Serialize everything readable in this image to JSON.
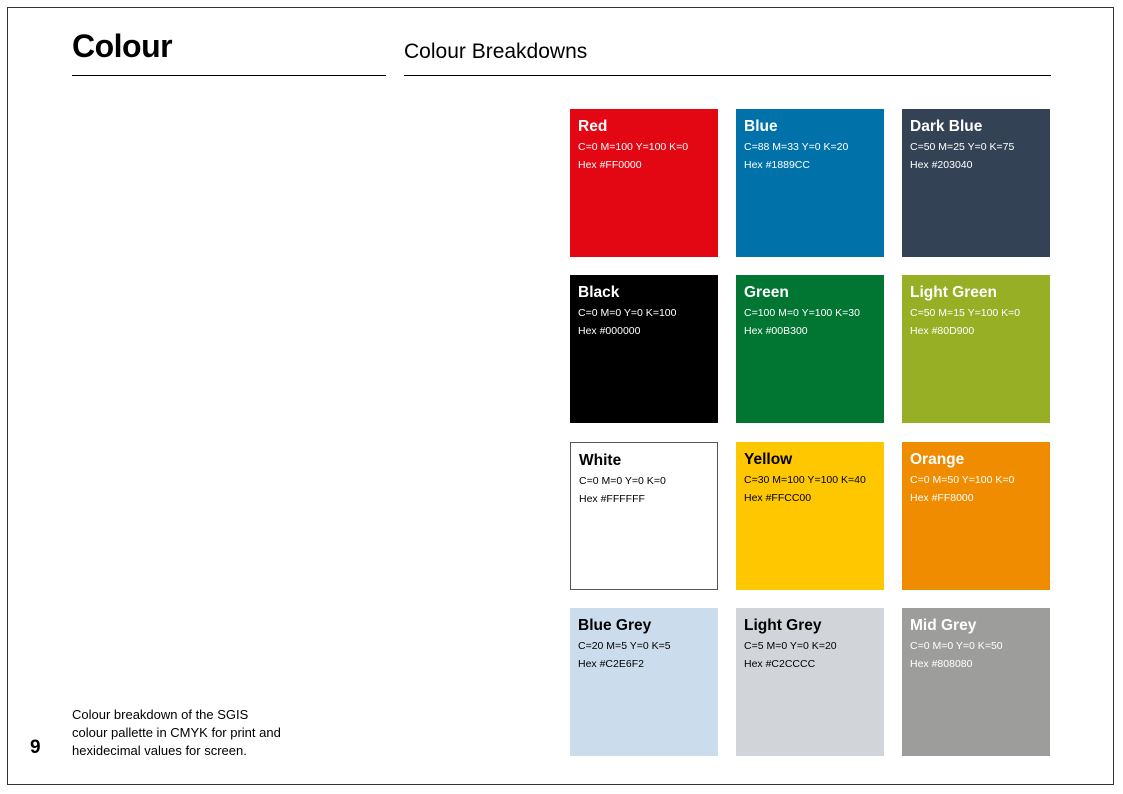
{
  "page": {
    "section_title": "Colour",
    "subtitle": "Colour Breakdowns",
    "page_number": "9",
    "caption_lines": [
      "Colour breakdown of the SGIS",
      "colour pallette in CMYK for print and",
      "hexidecimal values for screen."
    ]
  },
  "swatches": [
    {
      "name": "Red",
      "cmyk": "C=0 M=100 Y=100 K=0",
      "hex": "Hex #FF0000",
      "fill": "#E30613",
      "text_color": "#ffffff"
    },
    {
      "name": "Blue",
      "cmyk": "C=88 M=33 Y=0 K=20",
      "hex": "Hex #1889CC",
      "fill": "#0071A9",
      "text_color": "#ffffff"
    },
    {
      "name": "Dark Blue",
      "cmyk": "C=50 M=25 Y=0 K=75",
      "hex": "Hex #203040",
      "fill": "#344255",
      "text_color": "#ffffff"
    },
    {
      "name": "Black",
      "cmyk": "C=0 M=0 Y=0 K=100",
      "hex": "Hex #000000",
      "fill": "#000000",
      "text_color": "#ffffff"
    },
    {
      "name": "Green",
      "cmyk": "C=100 M=0 Y=100 K=30",
      "hex": "Hex #00B300",
      "fill": "#007632",
      "text_color": "#ffffff"
    },
    {
      "name": "Light Green",
      "cmyk": "C=50 M=15 Y=100 K=0",
      "hex": "Hex #80D900",
      "fill": "#97AF24",
      "text_color": "#ffffff"
    },
    {
      "name": "White",
      "cmyk": "C=0 M=0 Y=0 K=0",
      "hex": "Hex #FFFFFF",
      "fill": "#FFFFFF",
      "text_color": "#000000",
      "border": "#555555"
    },
    {
      "name": "Yellow",
      "cmyk": "C=30 M=100 Y=100 K=40",
      "hex": "Hex #FFCC00",
      "fill": "#FFC700",
      "text_color": "#000000"
    },
    {
      "name": "Orange",
      "cmyk": "C=0 M=50 Y=100 K=0",
      "hex": "Hex #FF8000",
      "fill": "#F08C00",
      "text_color": "#ffffff"
    },
    {
      "name": "Blue Grey",
      "cmyk": "C=20 M=5 Y=0 K=5",
      "hex": "Hex #C2E6F2",
      "fill": "#CBDCEC",
      "text_color": "#000000"
    },
    {
      "name": "Light Grey",
      "cmyk": "C=5 M=0 Y=0 K=20",
      "hex": "Hex #C2CCCC",
      "fill": "#D1D5D9",
      "text_color": "#000000"
    },
    {
      "name": "Mid Grey",
      "cmyk": "C=0 M=0 Y=0 K=50",
      "hex": "Hex #808080",
      "fill": "#9D9D9C",
      "text_color": "#ffffff"
    }
  ]
}
